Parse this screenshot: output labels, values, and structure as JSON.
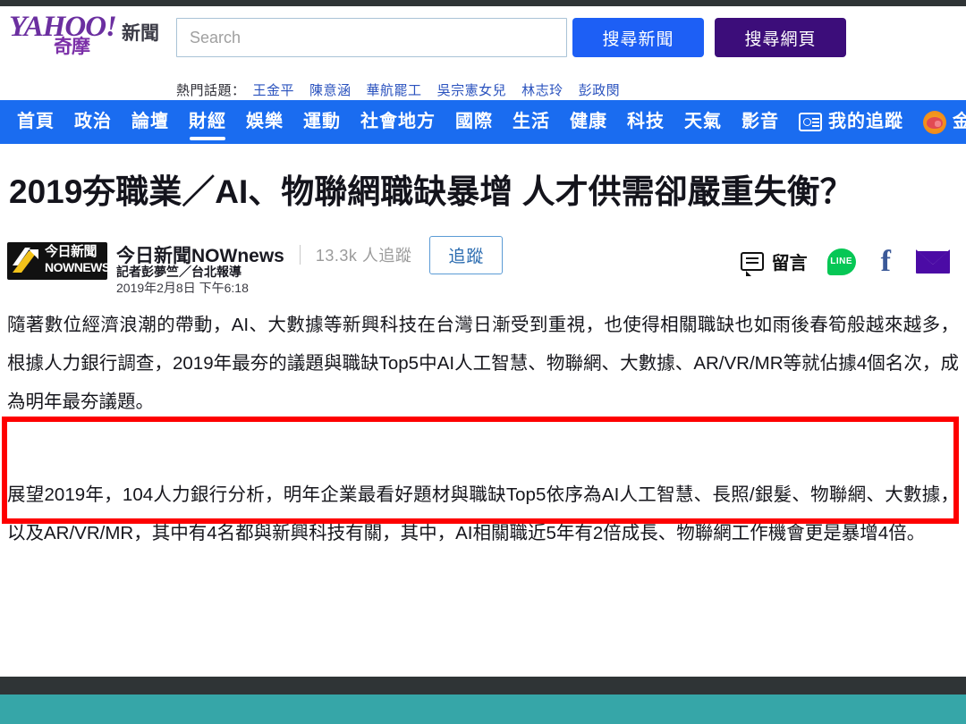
{
  "site": {
    "logo_brand": "YAHOO!",
    "logo_sub": "奇摩",
    "logo_section": "新聞"
  },
  "search": {
    "placeholder": "Search",
    "value": "",
    "news_button": "搜尋新聞",
    "web_button": "搜尋網頁"
  },
  "trending": {
    "label": "熱門話題：",
    "items": [
      {
        "label": "王金平"
      },
      {
        "label": "陳意涵"
      },
      {
        "label": "華航罷工"
      },
      {
        "label": "吳宗憲女兒"
      },
      {
        "label": "林志玲"
      },
      {
        "label": "彭政閔"
      }
    ]
  },
  "nav": {
    "items": [
      {
        "label": "首頁",
        "active": false,
        "icon": ""
      },
      {
        "label": "政治",
        "active": false,
        "icon": ""
      },
      {
        "label": "論壇",
        "active": false,
        "icon": ""
      },
      {
        "label": "財經",
        "active": true,
        "icon": ""
      },
      {
        "label": "娛樂",
        "active": false,
        "icon": ""
      },
      {
        "label": "運動",
        "active": false,
        "icon": ""
      },
      {
        "label": "社會地方",
        "active": false,
        "icon": ""
      },
      {
        "label": "國際",
        "active": false,
        "icon": ""
      },
      {
        "label": "生活",
        "active": false,
        "icon": ""
      },
      {
        "label": "健康",
        "active": false,
        "icon": ""
      },
      {
        "label": "科技",
        "active": false,
        "icon": ""
      },
      {
        "label": "天氣",
        "active": false,
        "icon": ""
      },
      {
        "label": "影音",
        "active": false,
        "icon": ""
      },
      {
        "label": "我的追蹤",
        "active": false,
        "icon": "id-card-icon"
      },
      {
        "label": "金豬",
        "active": false,
        "icon": "pig-icon"
      }
    ]
  },
  "article": {
    "headline": "2019夯職業／AI、物聯網職缺暴增 人才供需卻嚴重失衡？",
    "publisher": "今日新聞NOWnews",
    "publisher_logo_line1": "今日新聞",
    "publisher_logo_line2": "NOWNEWS",
    "followers": "13.3k 人追蹤",
    "follow_button": "追蹤",
    "reporter": "記者彭夢竺／台北報導",
    "published": "2019年2月8日 下午6:18",
    "paragraphs": [
      "隨著數位經濟浪潮的帶動，AI、大數據等新興科技在台灣日漸受到重視，也使得相關職缺也如雨後春筍般越來越多，根據人力銀行調查，2019年最夯的議題與職缺Top5中AI人工智慧、物聯網、大數據、AR/VR/MR等就佔據4個名次，成為明年最夯議題。",
      "展望2019年，104人力銀行分析，明年企業最看好題材與職缺Top5依序為AI人工智慧、長照/銀髮、物聯網、大數據，以及AR/VR/MR，其中有4名都與新興科技有關，其中，AI相關職近5年有2倍成長、物聯網工作機會更是暴增4倍。"
    ]
  },
  "social": {
    "comment_label": "留言",
    "line_label": "LINE",
    "facebook_label": "f",
    "items": [
      "comment-icon",
      "line-icon",
      "facebook-icon",
      "mail-icon"
    ]
  },
  "annotation": {
    "color": "#fe0000",
    "shape": "rectangle"
  },
  "colors": {
    "nav_blue": "#1a6cf0",
    "search_news_blue": "#1d5ff5",
    "search_web_purple": "#3c0d7a",
    "yahoo_purple": "#6b2fa0",
    "annotation_red": "#fe0000",
    "footer_teal": "#36a6a8",
    "footer_dark": "#2f3436"
  }
}
